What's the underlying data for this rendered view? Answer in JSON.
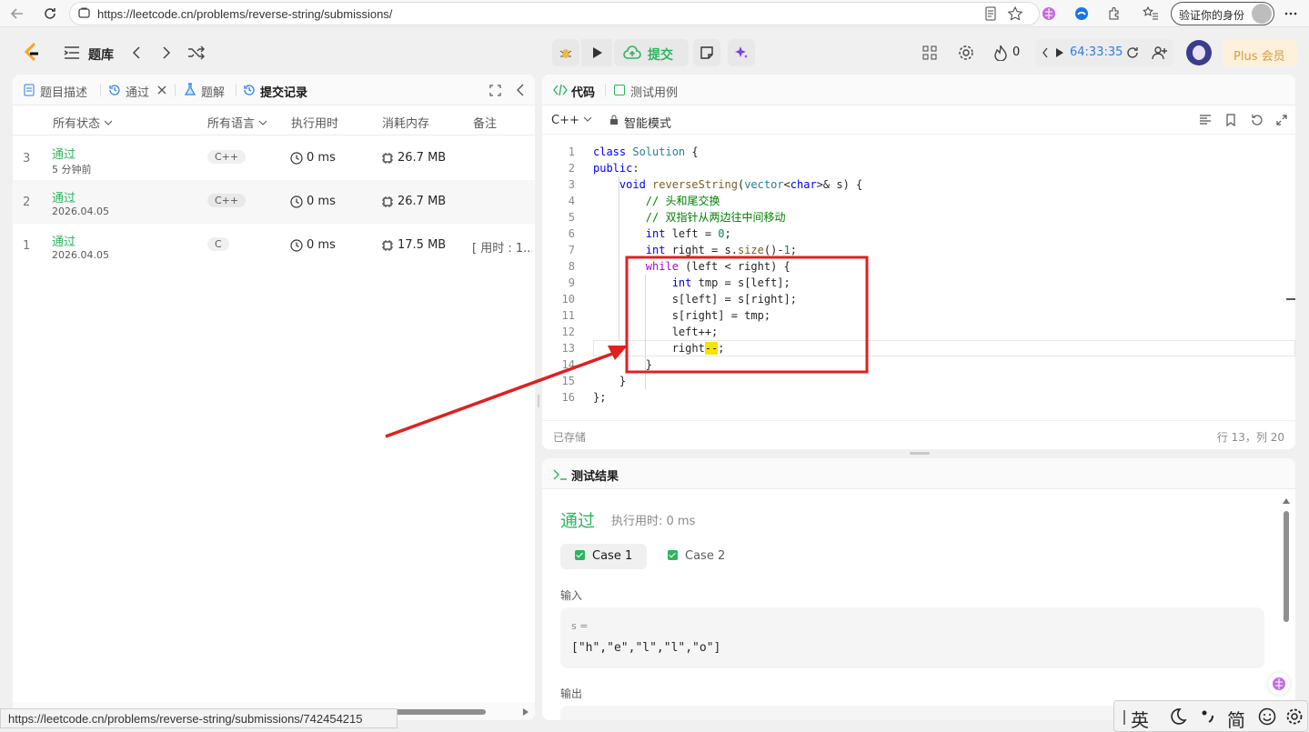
{
  "browser": {
    "url": "https://leetcode.cn/problems/reverse-string/submissions/",
    "verify_label": "验证你的身份",
    "status_url": "https://leetcode.cn/problems/reverse-string/submissions/742454215"
  },
  "nav": {
    "problem_bank": "题库",
    "submit_label": "提交",
    "streak_count": "0",
    "timer": "64:33:35",
    "plus_label": "Plus 会员"
  },
  "left_tabs": {
    "description": "题目描述",
    "accepted": "通过",
    "solutions": "题解",
    "submissions": "提交记录"
  },
  "table": {
    "headers": {
      "status": "所有状态",
      "language": "所有语言",
      "runtime": "执行用时",
      "memory": "消耗内存",
      "notes": "备注"
    },
    "rows": [
      {
        "index": "3",
        "status": "通过",
        "date": "5 分钟前",
        "lang": "C++",
        "runtime": "0 ms",
        "memory": "26.7 MB",
        "note": ""
      },
      {
        "index": "2",
        "status": "通过",
        "date": "2026.04.05",
        "lang": "C++",
        "runtime": "0 ms",
        "memory": "26.7 MB",
        "note": ""
      },
      {
        "index": "1",
        "status": "通过",
        "date": "2026.04.05",
        "lang": "C",
        "runtime": "0 ms",
        "memory": "17.5 MB",
        "note": "[ 用时 : 1..."
      }
    ]
  },
  "editor": {
    "tab_code": "代码",
    "tab_testcase": "测试用例",
    "language": "C++",
    "mode": "智能模式",
    "saved": "已存储",
    "cursor": "行 13，列 20",
    "line_numbers": [
      "1",
      "2",
      "3",
      "4",
      "5",
      "6",
      "7",
      "8",
      "9",
      "10",
      "11",
      "12",
      "13",
      "14",
      "15",
      "16"
    ]
  },
  "results": {
    "title": "测试结果",
    "status": "通过",
    "runtime": "执行用时: 0 ms",
    "case1": "Case 1",
    "case2": "Case 2",
    "input_label": "输入",
    "var_label": "s =",
    "input_value": "[\"h\",\"e\",\"l\",\"l\",\"o\"]",
    "output_label": "输出"
  },
  "ime": {
    "lang": "英",
    "simplified": "简"
  },
  "colors": {
    "accent_green": "#2db55d",
    "annotation_red": "#e02020",
    "plus_gold": "#d79b3b",
    "timer_blue": "#2b7de9"
  }
}
